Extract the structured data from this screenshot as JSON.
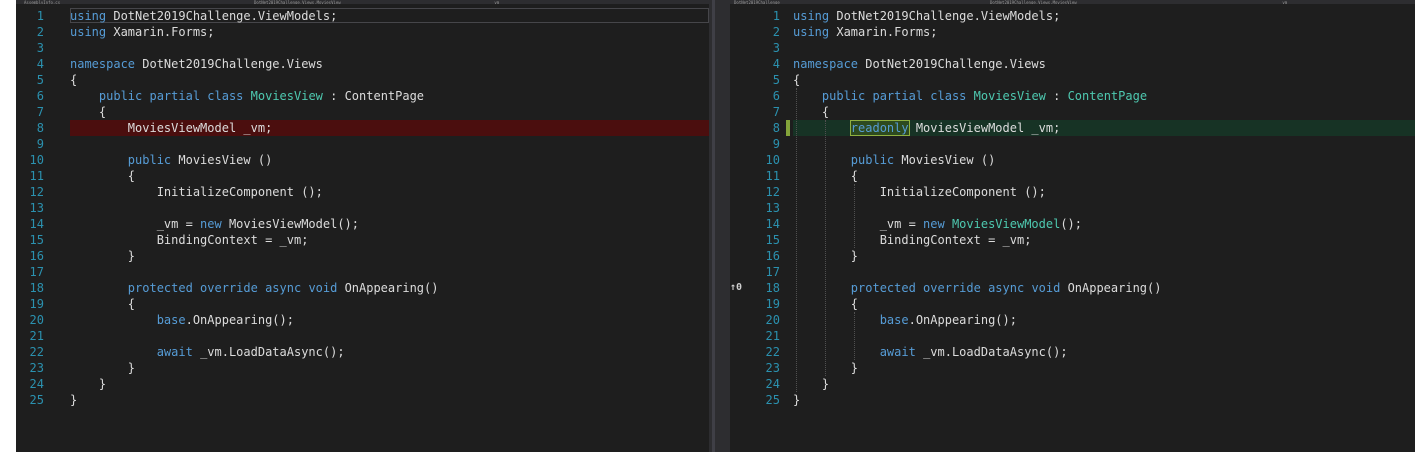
{
  "left": {
    "tabs": [
      "AssemblyInfo.cs",
      "DotNet2019Challenge.Views.MoviesView",
      "_vm"
    ],
    "lines": [
      {
        "n": "1",
        "tokens": [
          {
            "t": "using ",
            "c": "kw"
          },
          {
            "t": "DotNet2019Challenge.ViewModels;"
          }
        ]
      },
      {
        "n": "2",
        "tokens": [
          {
            "t": "using ",
            "c": "kw"
          },
          {
            "t": "Xamarin.Forms;"
          }
        ]
      },
      {
        "n": "3",
        "tokens": []
      },
      {
        "n": "4",
        "tokens": [
          {
            "t": "namespace ",
            "c": "kw"
          },
          {
            "t": "DotNet2019Challenge.Views"
          }
        ]
      },
      {
        "n": "5",
        "tokens": [
          {
            "t": "{"
          }
        ]
      },
      {
        "n": "6",
        "tokens": [
          {
            "t": "    "
          },
          {
            "t": "public ",
            "c": "kw"
          },
          {
            "t": "partial ",
            "c": "kw"
          },
          {
            "t": "class ",
            "c": "kw"
          },
          {
            "t": "MoviesView",
            "c": "ty"
          },
          {
            "t": " : ContentPage"
          }
        ]
      },
      {
        "n": "7",
        "tokens": [
          {
            "t": "    {"
          }
        ]
      },
      {
        "n": "8",
        "tokens": [
          {
            "t": "        MoviesViewModel _vm;"
          }
        ],
        "state": "removed"
      },
      {
        "n": "9",
        "tokens": []
      },
      {
        "n": "10",
        "tokens": [
          {
            "t": "        "
          },
          {
            "t": "public ",
            "c": "kw"
          },
          {
            "t": "MoviesView ()"
          }
        ]
      },
      {
        "n": "11",
        "tokens": [
          {
            "t": "        {"
          }
        ]
      },
      {
        "n": "12",
        "tokens": [
          {
            "t": "            InitializeComponent ();"
          }
        ]
      },
      {
        "n": "13",
        "tokens": []
      },
      {
        "n": "14",
        "tokens": [
          {
            "t": "            _vm = "
          },
          {
            "t": "new ",
            "c": "kw"
          },
          {
            "t": "MoviesViewModel();"
          }
        ]
      },
      {
        "n": "15",
        "tokens": [
          {
            "t": "            BindingContext = _vm;"
          }
        ]
      },
      {
        "n": "16",
        "tokens": [
          {
            "t": "        }"
          }
        ]
      },
      {
        "n": "17",
        "tokens": []
      },
      {
        "n": "18",
        "tokens": [
          {
            "t": "        "
          },
          {
            "t": "protected ",
            "c": "kw"
          },
          {
            "t": "override ",
            "c": "kw"
          },
          {
            "t": "async ",
            "c": "kw"
          },
          {
            "t": "void ",
            "c": "kw"
          },
          {
            "t": "OnAppearing()"
          }
        ]
      },
      {
        "n": "19",
        "tokens": [
          {
            "t": "        {"
          }
        ]
      },
      {
        "n": "20",
        "tokens": [
          {
            "t": "            "
          },
          {
            "t": "base",
            "c": "kw"
          },
          {
            "t": ".OnAppearing();"
          }
        ]
      },
      {
        "n": "21",
        "tokens": []
      },
      {
        "n": "22",
        "tokens": [
          {
            "t": "            "
          },
          {
            "t": "await ",
            "c": "kw"
          },
          {
            "t": "_vm.LoadDataAsync();"
          }
        ]
      },
      {
        "n": "23",
        "tokens": [
          {
            "t": "        }"
          }
        ]
      },
      {
        "n": "24",
        "tokens": [
          {
            "t": "    }"
          }
        ]
      },
      {
        "n": "25",
        "tokens": [
          {
            "t": "}"
          }
        ]
      }
    ]
  },
  "right": {
    "tabs": [
      "DotNet2019Challenge",
      "DotNet2019Challenge.Views.MoviesView",
      "_vm"
    ],
    "reference_indicator": "↑0",
    "lines": [
      {
        "n": "1",
        "tokens": [
          {
            "t": "using ",
            "c": "kw"
          },
          {
            "t": "DotNet2019Challenge.ViewModels;"
          }
        ]
      },
      {
        "n": "2",
        "tokens": [
          {
            "t": "using ",
            "c": "kw"
          },
          {
            "t": "Xamarin.Forms;"
          }
        ]
      },
      {
        "n": "3",
        "tokens": []
      },
      {
        "n": "4",
        "tokens": [
          {
            "t": "namespace ",
            "c": "kw"
          },
          {
            "t": "DotNet2019Challenge.Views"
          }
        ]
      },
      {
        "n": "5",
        "tokens": [
          {
            "t": "{"
          }
        ]
      },
      {
        "n": "6",
        "tokens": [
          {
            "t": "    "
          },
          {
            "t": "public ",
            "c": "kw"
          },
          {
            "t": "partial ",
            "c": "kw"
          },
          {
            "t": "class ",
            "c": "kw"
          },
          {
            "t": "MoviesView",
            "c": "ty"
          },
          {
            "t": " : "
          },
          {
            "t": "ContentPage",
            "c": "ty"
          }
        ]
      },
      {
        "n": "7",
        "tokens": [
          {
            "t": "    {"
          }
        ]
      },
      {
        "n": "8",
        "tokens": [
          {
            "t": "        "
          },
          {
            "t": "readonly",
            "c": "kw",
            "hl": true
          },
          {
            "t": " MoviesViewModel _vm;"
          }
        ],
        "state": "added"
      },
      {
        "n": "9",
        "tokens": []
      },
      {
        "n": "10",
        "tokens": [
          {
            "t": "        "
          },
          {
            "t": "public ",
            "c": "kw"
          },
          {
            "t": "MoviesView ()"
          }
        ]
      },
      {
        "n": "11",
        "tokens": [
          {
            "t": "        {"
          }
        ]
      },
      {
        "n": "12",
        "tokens": [
          {
            "t": "            InitializeComponent ();"
          }
        ]
      },
      {
        "n": "13",
        "tokens": []
      },
      {
        "n": "14",
        "tokens": [
          {
            "t": "            _vm = "
          },
          {
            "t": "new ",
            "c": "kw"
          },
          {
            "t": "MoviesViewModel",
            "c": "ty"
          },
          {
            "t": "();"
          }
        ]
      },
      {
        "n": "15",
        "tokens": [
          {
            "t": "            BindingContext = _vm;"
          }
        ]
      },
      {
        "n": "16",
        "tokens": [
          {
            "t": "        }"
          }
        ]
      },
      {
        "n": "17",
        "tokens": []
      },
      {
        "n": "18",
        "tokens": [
          {
            "t": "        "
          },
          {
            "t": "protected ",
            "c": "kw"
          },
          {
            "t": "override ",
            "c": "kw"
          },
          {
            "t": "async ",
            "c": "kw"
          },
          {
            "t": "void ",
            "c": "kw"
          },
          {
            "t": "OnAppearing()"
          }
        ],
        "indicator": true
      },
      {
        "n": "19",
        "tokens": [
          {
            "t": "        {"
          }
        ]
      },
      {
        "n": "20",
        "tokens": [
          {
            "t": "            "
          },
          {
            "t": "base",
            "c": "kw"
          },
          {
            "t": ".OnAppearing();"
          }
        ]
      },
      {
        "n": "21",
        "tokens": []
      },
      {
        "n": "22",
        "tokens": [
          {
            "t": "            "
          },
          {
            "t": "await ",
            "c": "kw"
          },
          {
            "t": "_vm.LoadDataAsync();"
          }
        ]
      },
      {
        "n": "23",
        "tokens": [
          {
            "t": "        }"
          }
        ]
      },
      {
        "n": "24",
        "tokens": [
          {
            "t": "    }"
          }
        ]
      },
      {
        "n": "25",
        "tokens": [
          {
            "t": "}"
          }
        ]
      }
    ]
  },
  "colors": {
    "keyword": "#569cd6",
    "type": "#4ec9b0",
    "line_number": "#2b91af",
    "removed_bg": "#4b0e0e",
    "added_bg": "#173325"
  }
}
